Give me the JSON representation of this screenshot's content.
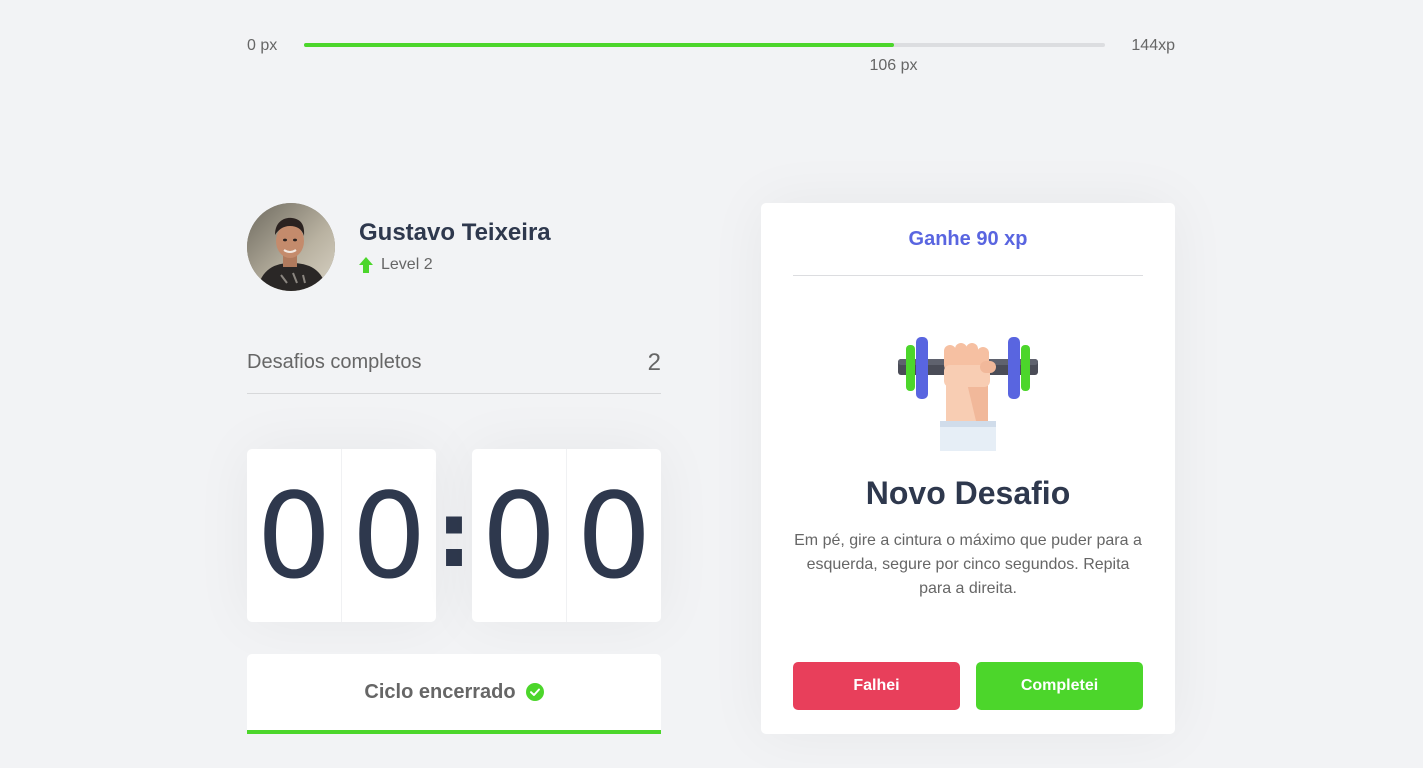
{
  "xp_bar": {
    "min_label": "0 px",
    "max_label": "144xp",
    "current_label": "106 px",
    "progress_fraction": 0.736,
    "fill_color": "#4cd62b"
  },
  "profile": {
    "name": "Gustavo Teixeira",
    "level_label": "Level 2",
    "level_icon": "level-up-arrow-icon"
  },
  "completed_challenges": {
    "label": "Desafios completos",
    "count": "2"
  },
  "countdown": {
    "minute_left": "0",
    "minute_right": "0",
    "separator": ":",
    "second_left": "0",
    "second_right": "0"
  },
  "cycle_button": {
    "label": "Ciclo encerrado",
    "icon": "check-circle-icon",
    "accent_color": "#4cd62b"
  },
  "challenge": {
    "gain_label": "Ganhe 90 xp",
    "icon": "dumbbell-icon",
    "title": "Novo Desafio",
    "description": "Em pé, gire a cintura o máximo que puder para a esquerda, segure por cinco segundos. Repita para a direita.",
    "fail_label": "Falhei",
    "complete_label": "Completei",
    "fail_color": "#e83f5b",
    "complete_color": "#4cd62b",
    "gain_color": "#5965e0"
  }
}
